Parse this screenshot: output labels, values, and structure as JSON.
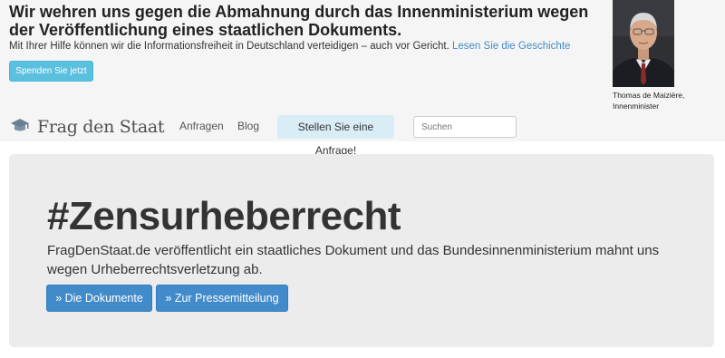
{
  "banner": {
    "title": "Wir wehren uns gegen die Abmahnung durch das Innenministerium wegen der Veröffentlichung eines staatlichen Dokuments.",
    "text": "Mit Ihrer Hilfe können wir die Informationsfreiheit in Deutschland verteidigen – auch vor Gericht.",
    "link": "Lesen Sie die Geschichte",
    "donate_label": "Spenden Sie jetzt",
    "photo_caption_name": "Thomas de Maizière,",
    "photo_caption_role": "Innenminister"
  },
  "navbar": {
    "brand": "Frag den Staat",
    "links": [
      "Anfragen",
      "Blog"
    ],
    "cta": "Stellen Sie eine Anfrage!",
    "search_placeholder": "Suchen"
  },
  "hero": {
    "title": "#Zensurheberrecht",
    "text": "FragDenStaat.de veröffentlicht ein staatliches Dokument und das Bundesinnenministerium mahnt uns wegen Urheberrechtsverletzung ab.",
    "buttons": [
      "» Die Dokumente",
      "» Zur Pressemitteilung"
    ]
  },
  "colors": {
    "accent": "#428bca",
    "info": "#5bc0de",
    "nav_highlight": "#d9edf7"
  }
}
